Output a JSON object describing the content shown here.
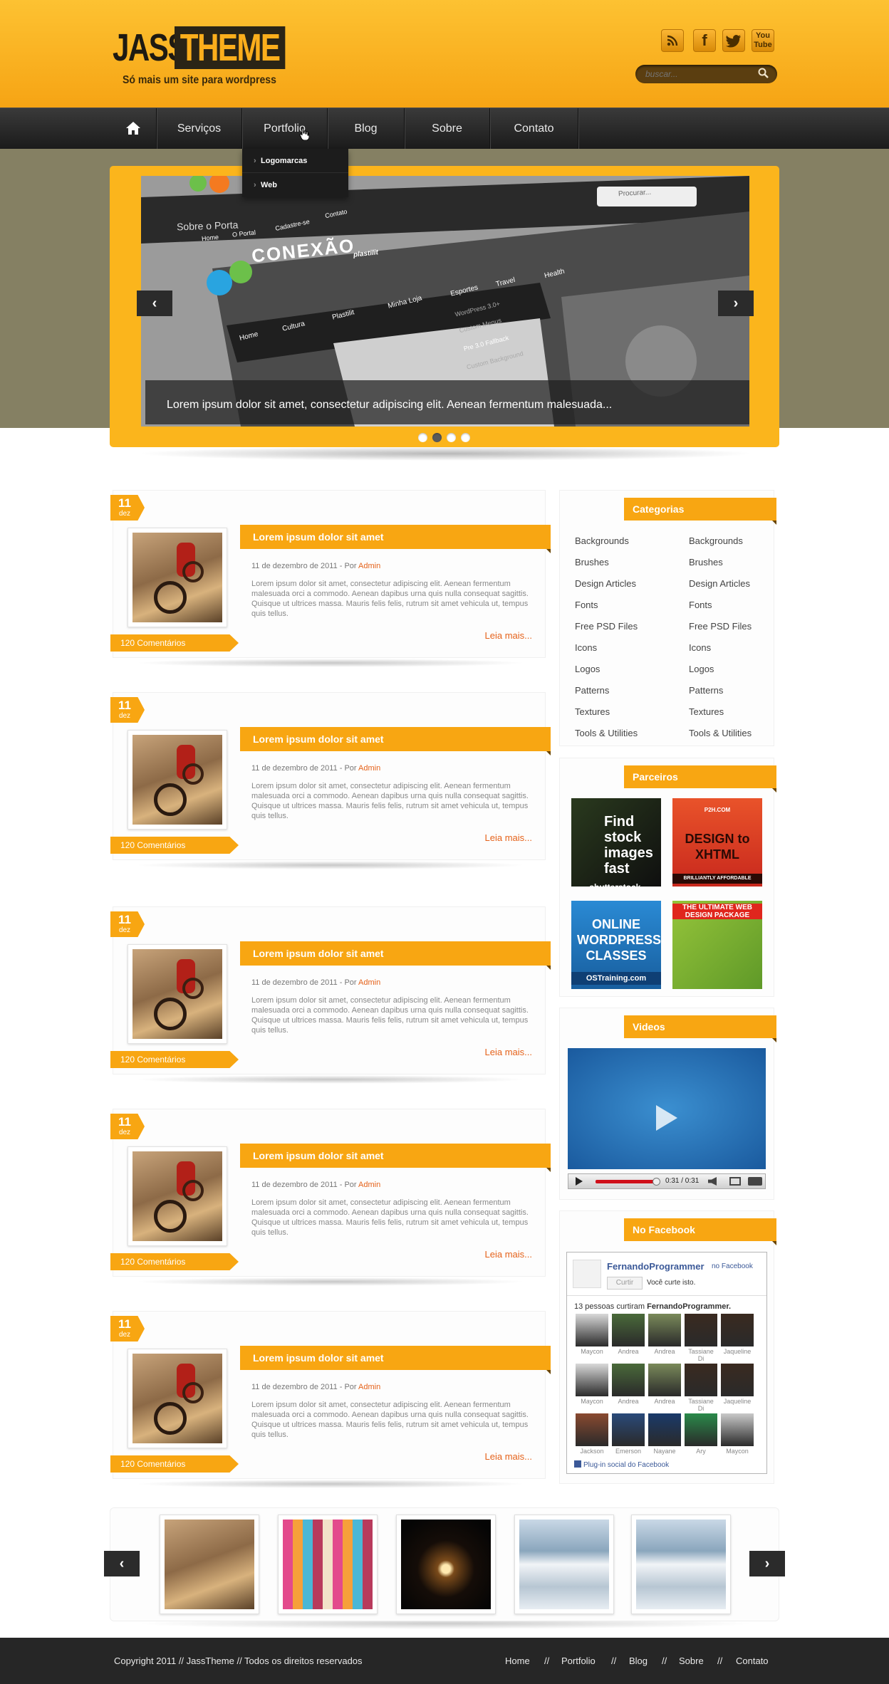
{
  "header": {
    "logo_left": "JASS",
    "logo_right": "THEME",
    "tagline": "Só mais um site para wordpress",
    "search_placeholder": "buscar...",
    "social": [
      "RSS",
      "f",
      "t",
      "You Tube"
    ]
  },
  "nav": {
    "items": [
      "Serviços",
      "Portfolio",
      "Blog",
      "Sobre",
      "Contato"
    ],
    "dropdown": [
      "Logomarcas",
      "Web"
    ]
  },
  "slider": {
    "caption": "Lorem ipsum dolor sit amet, consectetur adipiscing elit. Aenean fermentum malesuada...",
    "prev": "‹",
    "next": "›",
    "dots": 4,
    "active_dot": 2,
    "image_texts": {
      "search": "Procurar...",
      "brand": "CONEXÃO",
      "brand_sub": "plastilit",
      "top_links": [
        "Home",
        "O Portal",
        "Cadastre-se",
        "Contato"
      ],
      "menu": [
        "Home",
        "Cultura",
        "Plastilit",
        "Minha Loja",
        "Esportes",
        "Travel",
        "Health"
      ],
      "submenu": [
        "WordPress 3.0+",
        "Custom Menus",
        "Pre 3.0 Fallback",
        "Custom Background"
      ],
      "tab": "Sobre o Porta"
    }
  },
  "posts": [
    {
      "day": "11",
      "month": "dez",
      "title": "Lorem ipsum dolor sit amet",
      "meta": "11 de dezembro de 2011 - Por ",
      "author": "Admin",
      "excerpt": "Lorem ipsum dolor sit amet, consectetur adipiscing elit. Aenean fermentum malesuada orci a commodo. Aenean dapibus urna quis nulla consequat sagittis. Quisque ut ultrices massa. Mauris felis felis, rutrum sit amet vehicula ut, tempus quis tellus.",
      "read_more": "Leia mais...",
      "comments": "120 Comentários"
    },
    {
      "day": "11",
      "month": "dez",
      "title": "Lorem ipsum dolor sit amet",
      "meta": "11 de dezembro de 2011 - Por ",
      "author": "Admin",
      "excerpt": "Lorem ipsum dolor sit amet, consectetur adipiscing elit. Aenean fermentum malesuada orci a commodo. Aenean dapibus urna quis nulla consequat sagittis. Quisque ut ultrices massa. Mauris felis felis, rutrum sit amet vehicula ut, tempus quis tellus.",
      "read_more": "Leia mais...",
      "comments": "120 Comentários"
    },
    {
      "day": "11",
      "month": "dez",
      "title": "Lorem ipsum dolor sit amet",
      "meta": "11 de dezembro de 2011 - Por ",
      "author": "Admin",
      "excerpt": "Lorem ipsum dolor sit amet, consectetur adipiscing elit. Aenean fermentum malesuada orci a commodo. Aenean dapibus urna quis nulla consequat sagittis. Quisque ut ultrices massa. Mauris felis felis, rutrum sit amet vehicula ut, tempus quis tellus.",
      "read_more": "Leia mais...",
      "comments": "120 Comentários"
    },
    {
      "day": "11",
      "month": "dez",
      "title": "Lorem ipsum dolor sit amet",
      "meta": "11 de dezembro de 2011 - Por ",
      "author": "Admin",
      "excerpt": "Lorem ipsum dolor sit amet, consectetur adipiscing elit. Aenean fermentum malesuada orci a commodo. Aenean dapibus urna quis nulla consequat sagittis. Quisque ut ultrices massa. Mauris felis felis, rutrum sit amet vehicula ut, tempus quis tellus.",
      "read_more": "Leia mais...",
      "comments": "120 Comentários"
    },
    {
      "day": "11",
      "month": "dez",
      "title": "Lorem ipsum dolor sit amet",
      "meta": "11 de dezembro de 2011 - Por ",
      "author": "Admin",
      "excerpt": "Lorem ipsum dolor sit amet, consectetur adipiscing elit. Aenean fermentum malesuada orci a commodo. Aenean dapibus urna quis nulla consequat sagittis. Quisque ut ultrices massa. Mauris felis felis, rutrum sit amet vehicula ut, tempus quis tellus.",
      "read_more": "Leia mais...",
      "comments": "120 Comentários"
    }
  ],
  "sidebar": {
    "categories": {
      "title": "Categorias",
      "items": [
        "Backgrounds",
        "Brushes",
        "Design Articles",
        "Fonts",
        "Free PSD Files",
        "Icons",
        "Logos",
        "Patterns",
        "Textures",
        "Tools & Utilities"
      ]
    },
    "partners": {
      "title": "Parceiros",
      "banners": [
        {
          "text": "Find stock images fast",
          "sub": "shutterstock."
        },
        {
          "text": "DESIGN to XHTML",
          "sub": "BRILLIANTLY AFFORDABLE",
          "top": "P2H.COM"
        },
        {
          "text": "ONLINE WORDPRESS CLASSES",
          "sub": "OSTraining.com"
        },
        {
          "text": "THE ULTIMATE WEB DESIGN PACKAGE",
          "sub": ""
        }
      ]
    },
    "videos": {
      "title": "Videos",
      "time": "0:31 / 0:31"
    },
    "facebook": {
      "title": "No Facebook",
      "page_name": "FernandoProgrammer",
      "on_facebook": "no Facebook",
      "like_button": "Curtir",
      "you_like": "Você curte isto.",
      "count_prefix": "13 pessoas curtiram ",
      "count_name": "FernandoProgrammer.",
      "people": [
        "Maycon",
        "Andrea",
        "Andrea",
        "Tassiane Di",
        "Jaqueline",
        "Maycon",
        "Andrea",
        "Andrea",
        "Tassiane Di",
        "Jaqueline",
        "Jackson",
        "Emerson",
        "Nayane",
        "Ary",
        "Maycon"
      ],
      "plugin_label": "Plug-in social do Facebook"
    }
  },
  "gallery": {
    "prev": "‹",
    "next": "›"
  },
  "footer": {
    "copyright": "Copyright 2011 // JassTheme // Todos os direitos reservados",
    "links": [
      "Home",
      "Portfolio",
      "Blog",
      "Sobre",
      "Contato"
    ],
    "separator": "//"
  },
  "colors": {
    "accent": "#f8a612",
    "header_top": "#fdc232",
    "nav": "#1b1b1b",
    "link": "#e5621a"
  }
}
